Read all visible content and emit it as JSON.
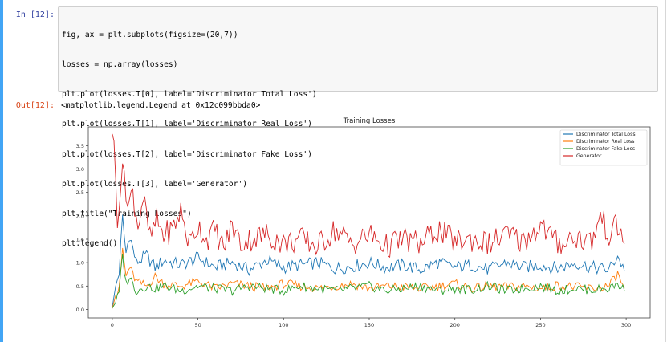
{
  "cell": {
    "in_prompt": "In  [12]:",
    "out_prompt": "Out[12]:",
    "code_lines": [
      "fig, ax = plt.subplots(figsize=(20,7))",
      "losses = np.array(losses)",
      "plt.plot(losses.T[0], label='Discriminator Total Loss')",
      "plt.plot(losses.T[1], label='Discriminator Real Loss')",
      "plt.plot(losses.T[2], label='Discriminator Fake Loss')",
      "plt.plot(losses.T[3], label='Generator')",
      "plt.title(\"Training Losses\")",
      "plt.legend()"
    ],
    "output_text": "<matplotlib.legend.Legend at 0x12c099bbda0>"
  },
  "colors": {
    "cell_bar": "#42a5f5",
    "in_prompt": "#303f9f",
    "out_prompt": "#d84315",
    "code_bg": "#f7f7f7"
  },
  "chart_data": {
    "type": "line",
    "title": "Training Losses",
    "xlabel": "",
    "ylabel": "",
    "xlim": [
      -14,
      314
    ],
    "ylim": [
      -0.18,
      3.9
    ],
    "xticks": [
      0,
      50,
      100,
      150,
      200,
      250,
      300
    ],
    "yticks": [
      0.0,
      0.5,
      1.0,
      1.5,
      2.0,
      2.5,
      3.0,
      3.5
    ],
    "ytick_labels": [
      "0.0",
      "0.5",
      "1.0",
      "1.5",
      "2.0",
      "2.5",
      "3.0",
      "3.5"
    ],
    "legend_position": "top-right",
    "grid": false,
    "series": [
      {
        "name": "Discriminator Total Loss",
        "color": "#1f77b4",
        "x": [
          0,
          2,
          4,
          6,
          8,
          10,
          14,
          20,
          25,
          30,
          40,
          50,
          60,
          70,
          80,
          90,
          100,
          110,
          120,
          130,
          140,
          150,
          160,
          170,
          180,
          190,
          200,
          210,
          220,
          230,
          240,
          250,
          260,
          270,
          280,
          290,
          295,
          299
        ],
        "y": [
          0.05,
          0.5,
          0.8,
          1.95,
          1.2,
          1.6,
          1.0,
          1.15,
          0.9,
          1.05,
          0.95,
          1.1,
          0.9,
          1.0,
          0.85,
          1.05,
          0.9,
          0.95,
          1.0,
          0.88,
          0.92,
          1.0,
          0.9,
          0.95,
          0.85,
          1.0,
          0.9,
          0.95,
          0.85,
          1.0,
          0.9,
          0.95,
          0.88,
          1.0,
          0.9,
          0.85,
          1.15,
          0.82
        ]
      },
      {
        "name": "Discriminator Real Loss",
        "color": "#ff7f0e",
        "x": [
          0,
          2,
          4,
          6,
          8,
          10,
          14,
          20,
          25,
          30,
          40,
          50,
          60,
          70,
          80,
          90,
          100,
          110,
          120,
          130,
          140,
          150,
          160,
          170,
          180,
          190,
          200,
          210,
          220,
          230,
          240,
          250,
          260,
          270,
          280,
          290,
          295,
          299
        ],
        "y": [
          0.02,
          0.3,
          0.4,
          1.3,
          0.7,
          0.9,
          0.6,
          0.5,
          0.7,
          0.55,
          0.5,
          0.6,
          0.45,
          0.55,
          0.5,
          0.45,
          0.55,
          0.5,
          0.45,
          0.5,
          0.55,
          0.45,
          0.5,
          0.48,
          0.45,
          0.5,
          0.55,
          0.45,
          0.5,
          0.48,
          0.5,
          0.45,
          0.52,
          0.48,
          0.45,
          0.5,
          0.75,
          0.45
        ]
      },
      {
        "name": "Discriminator Fake Loss",
        "color": "#2ca02c",
        "x": [
          0,
          2,
          4,
          6,
          8,
          10,
          14,
          20,
          25,
          30,
          40,
          50,
          60,
          70,
          80,
          90,
          100,
          110,
          120,
          130,
          140,
          150,
          160,
          170,
          180,
          190,
          200,
          210,
          220,
          230,
          240,
          250,
          260,
          270,
          280,
          290,
          295,
          299
        ],
        "y": [
          0.03,
          0.15,
          0.35,
          1.15,
          0.55,
          0.7,
          0.4,
          0.5,
          0.45,
          0.5,
          0.4,
          0.5,
          0.45,
          0.4,
          0.5,
          0.45,
          0.4,
          0.5,
          0.45,
          0.4,
          0.45,
          0.5,
          0.4,
          0.45,
          0.5,
          0.4,
          0.45,
          0.42,
          0.5,
          0.4,
          0.45,
          0.5,
          0.4,
          0.45,
          0.42,
          0.45,
          0.55,
          0.4
        ]
      },
      {
        "name": "Generator",
        "color": "#d62728",
        "x": [
          0,
          1,
          3,
          5,
          7,
          9,
          12,
          15,
          18,
          22,
          26,
          30,
          35,
          40,
          45,
          50,
          55,
          60,
          65,
          70,
          75,
          80,
          90,
          100,
          110,
          120,
          130,
          140,
          150,
          160,
          170,
          180,
          190,
          200,
          210,
          220,
          230,
          240,
          250,
          260,
          270,
          280,
          285,
          290,
          295,
          299
        ],
        "y": [
          3.75,
          3.6,
          2.0,
          2.7,
          3.0,
          2.2,
          2.5,
          1.8,
          2.4,
          1.5,
          1.9,
          1.6,
          1.7,
          2.1,
          1.4,
          1.8,
          1.5,
          1.7,
          1.3,
          1.8,
          1.4,
          1.5,
          1.6,
          1.4,
          1.5,
          1.35,
          1.7,
          1.4,
          1.6,
          1.35,
          1.5,
          1.4,
          1.7,
          1.45,
          1.5,
          1.4,
          1.6,
          1.45,
          1.8,
          1.4,
          1.55,
          1.45,
          2.0,
          1.6,
          1.8,
          1.4
        ]
      }
    ]
  }
}
